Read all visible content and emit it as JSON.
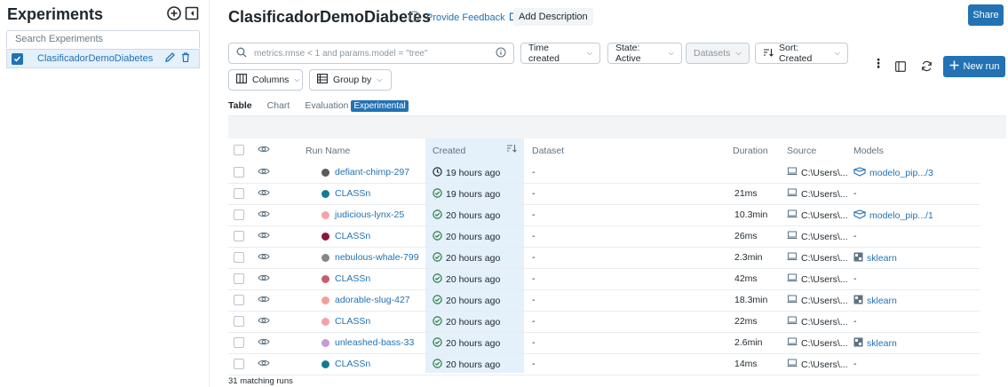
{
  "sidebar": {
    "title": "Experiments",
    "search_placeholder": "Search Experiments",
    "experiment_name": "ClasificadorDemoDiabetes"
  },
  "header": {
    "title": "ClasificadorDemoDiabetes",
    "feedback_label": "Provide Feedback",
    "add_description_label": "Add Description",
    "share_label": "Share"
  },
  "toolbar": {
    "search_placeholder": "metrics.rmse < 1 and params.model = \"tree\"",
    "time_created_label": "Time created",
    "state_label": "State: Active",
    "datasets_label": "Datasets",
    "sort_label": "Sort: Created",
    "columns_label": "Columns",
    "group_by_label": "Group by",
    "new_run_label": "New run"
  },
  "tabs": {
    "table": "Table",
    "chart": "Chart",
    "evaluation": "Evaluation",
    "experimental_badge": "Experimental"
  },
  "table": {
    "headers": {
      "run_name": "Run Name",
      "created": "Created",
      "dataset": "Dataset",
      "duration": "Duration",
      "source": "Source",
      "models": "Models"
    },
    "rows": [
      {
        "name": "defiant-chimp-297",
        "color": "#5a5a5a",
        "created": "19 hours ago",
        "status": "running",
        "dataset": "-",
        "duration": "",
        "source": "C:\\Users\\...",
        "model": "modelo_pip.../3",
        "model_icon": "model-registry"
      },
      {
        "name": "CLASSn",
        "color": "#137b91",
        "created": "19 hours ago",
        "status": "finished",
        "dataset": "-",
        "duration": "21ms",
        "source": "C:\\Users\\...",
        "model": "-",
        "model_icon": "none"
      },
      {
        "name": "judicious-lynx-25",
        "color": "#f4a3a9",
        "created": "20 hours ago",
        "status": "finished",
        "dataset": "-",
        "duration": "10.3min",
        "source": "C:\\Users\\...",
        "model": "modelo_pip.../1",
        "model_icon": "model-registry"
      },
      {
        "name": "CLASSn",
        "color": "#8a1738",
        "created": "20 hours ago",
        "status": "finished",
        "dataset": "-",
        "duration": "26ms",
        "source": "C:\\Users\\...",
        "model": "-",
        "model_icon": "none"
      },
      {
        "name": "nebulous-whale-799",
        "color": "#878787",
        "created": "20 hours ago",
        "status": "finished",
        "dataset": "-",
        "duration": "2.3min",
        "source": "C:\\Users\\...",
        "model": "sklearn",
        "model_icon": "sklearn"
      },
      {
        "name": "CLASSn",
        "color": "#c45e6b",
        "created": "20 hours ago",
        "status": "finished",
        "dataset": "-",
        "duration": "42ms",
        "source": "C:\\Users\\...",
        "model": "-",
        "model_icon": "none"
      },
      {
        "name": "adorable-slug-427",
        "color": "#f0a09a",
        "created": "20 hours ago",
        "status": "finished",
        "dataset": "-",
        "duration": "18.3min",
        "source": "C:\\Users\\...",
        "model": "sklearn",
        "model_icon": "sklearn"
      },
      {
        "name": "CLASSn",
        "color": "#f4a3a9",
        "created": "20 hours ago",
        "status": "finished",
        "dataset": "-",
        "duration": "22ms",
        "source": "C:\\Users\\...",
        "model": "-",
        "model_icon": "none"
      },
      {
        "name": "unleashed-bass-33",
        "color": "#c49bd6",
        "created": "20 hours ago",
        "status": "finished",
        "dataset": "-",
        "duration": "2.6min",
        "source": "C:\\Users\\...",
        "model": "sklearn",
        "model_icon": "sklearn"
      },
      {
        "name": "CLASSn",
        "color": "#137b91",
        "created": "20 hours ago",
        "status": "finished",
        "dataset": "-",
        "duration": "14ms",
        "source": "C:\\Users\\...",
        "model": "-",
        "model_icon": "none"
      }
    ]
  },
  "footer": {
    "matching_runs": "31 matching runs"
  },
  "colors": {
    "accent": "#2272b4",
    "success": "#277c43",
    "selected_bg": "#e4f0fa"
  }
}
